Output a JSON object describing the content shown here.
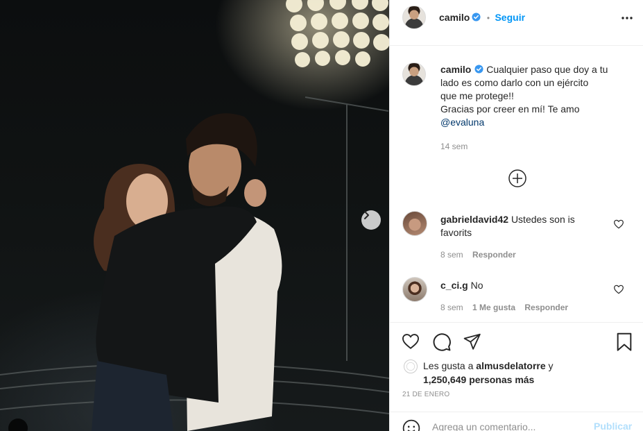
{
  "post": {
    "author": "camilo",
    "follow_label": "Seguir",
    "more_label": "•••",
    "separator": "•",
    "caption": {
      "line1": "Cualquier paso que doy a tu",
      "line2": "lado es como darlo con un ejército",
      "line3": "que me protege!!",
      "line4": "Gracias por creer en mí! Te amo",
      "mention": "@evaluna"
    },
    "caption_time": "14 sem",
    "date": "21 DE ENERO"
  },
  "comments": [
    {
      "user": "gabrieldavid42",
      "text_line1": "Ustedes son is",
      "text_line2": "favorits",
      "time": "8 sem",
      "reply_label": "Responder"
    },
    {
      "user": "c_ci.g",
      "text": "No",
      "time": "8 sem",
      "likes_label": "1 Me gusta",
      "reply_label": "Responder"
    }
  ],
  "likes": {
    "prefix": "Les gusta a",
    "user": "almusdelatorre",
    "conj": "y",
    "count": "1,250,649",
    "suffix": "personas más"
  },
  "add_comment": {
    "placeholder": "Agrega un comentario...",
    "publish_label": "Publicar"
  },
  "colors": {
    "accent": "#0095f6",
    "verified": "#3897f0",
    "publish_disabled": "#b2dffc"
  },
  "icons": [
    "more-options-icon",
    "verified-icon",
    "add-circle-icon",
    "heart-icon",
    "comment-icon",
    "share-icon",
    "bookmark-icon",
    "emoji-icon",
    "next-arrow-icon",
    "tag-user-icon"
  ]
}
